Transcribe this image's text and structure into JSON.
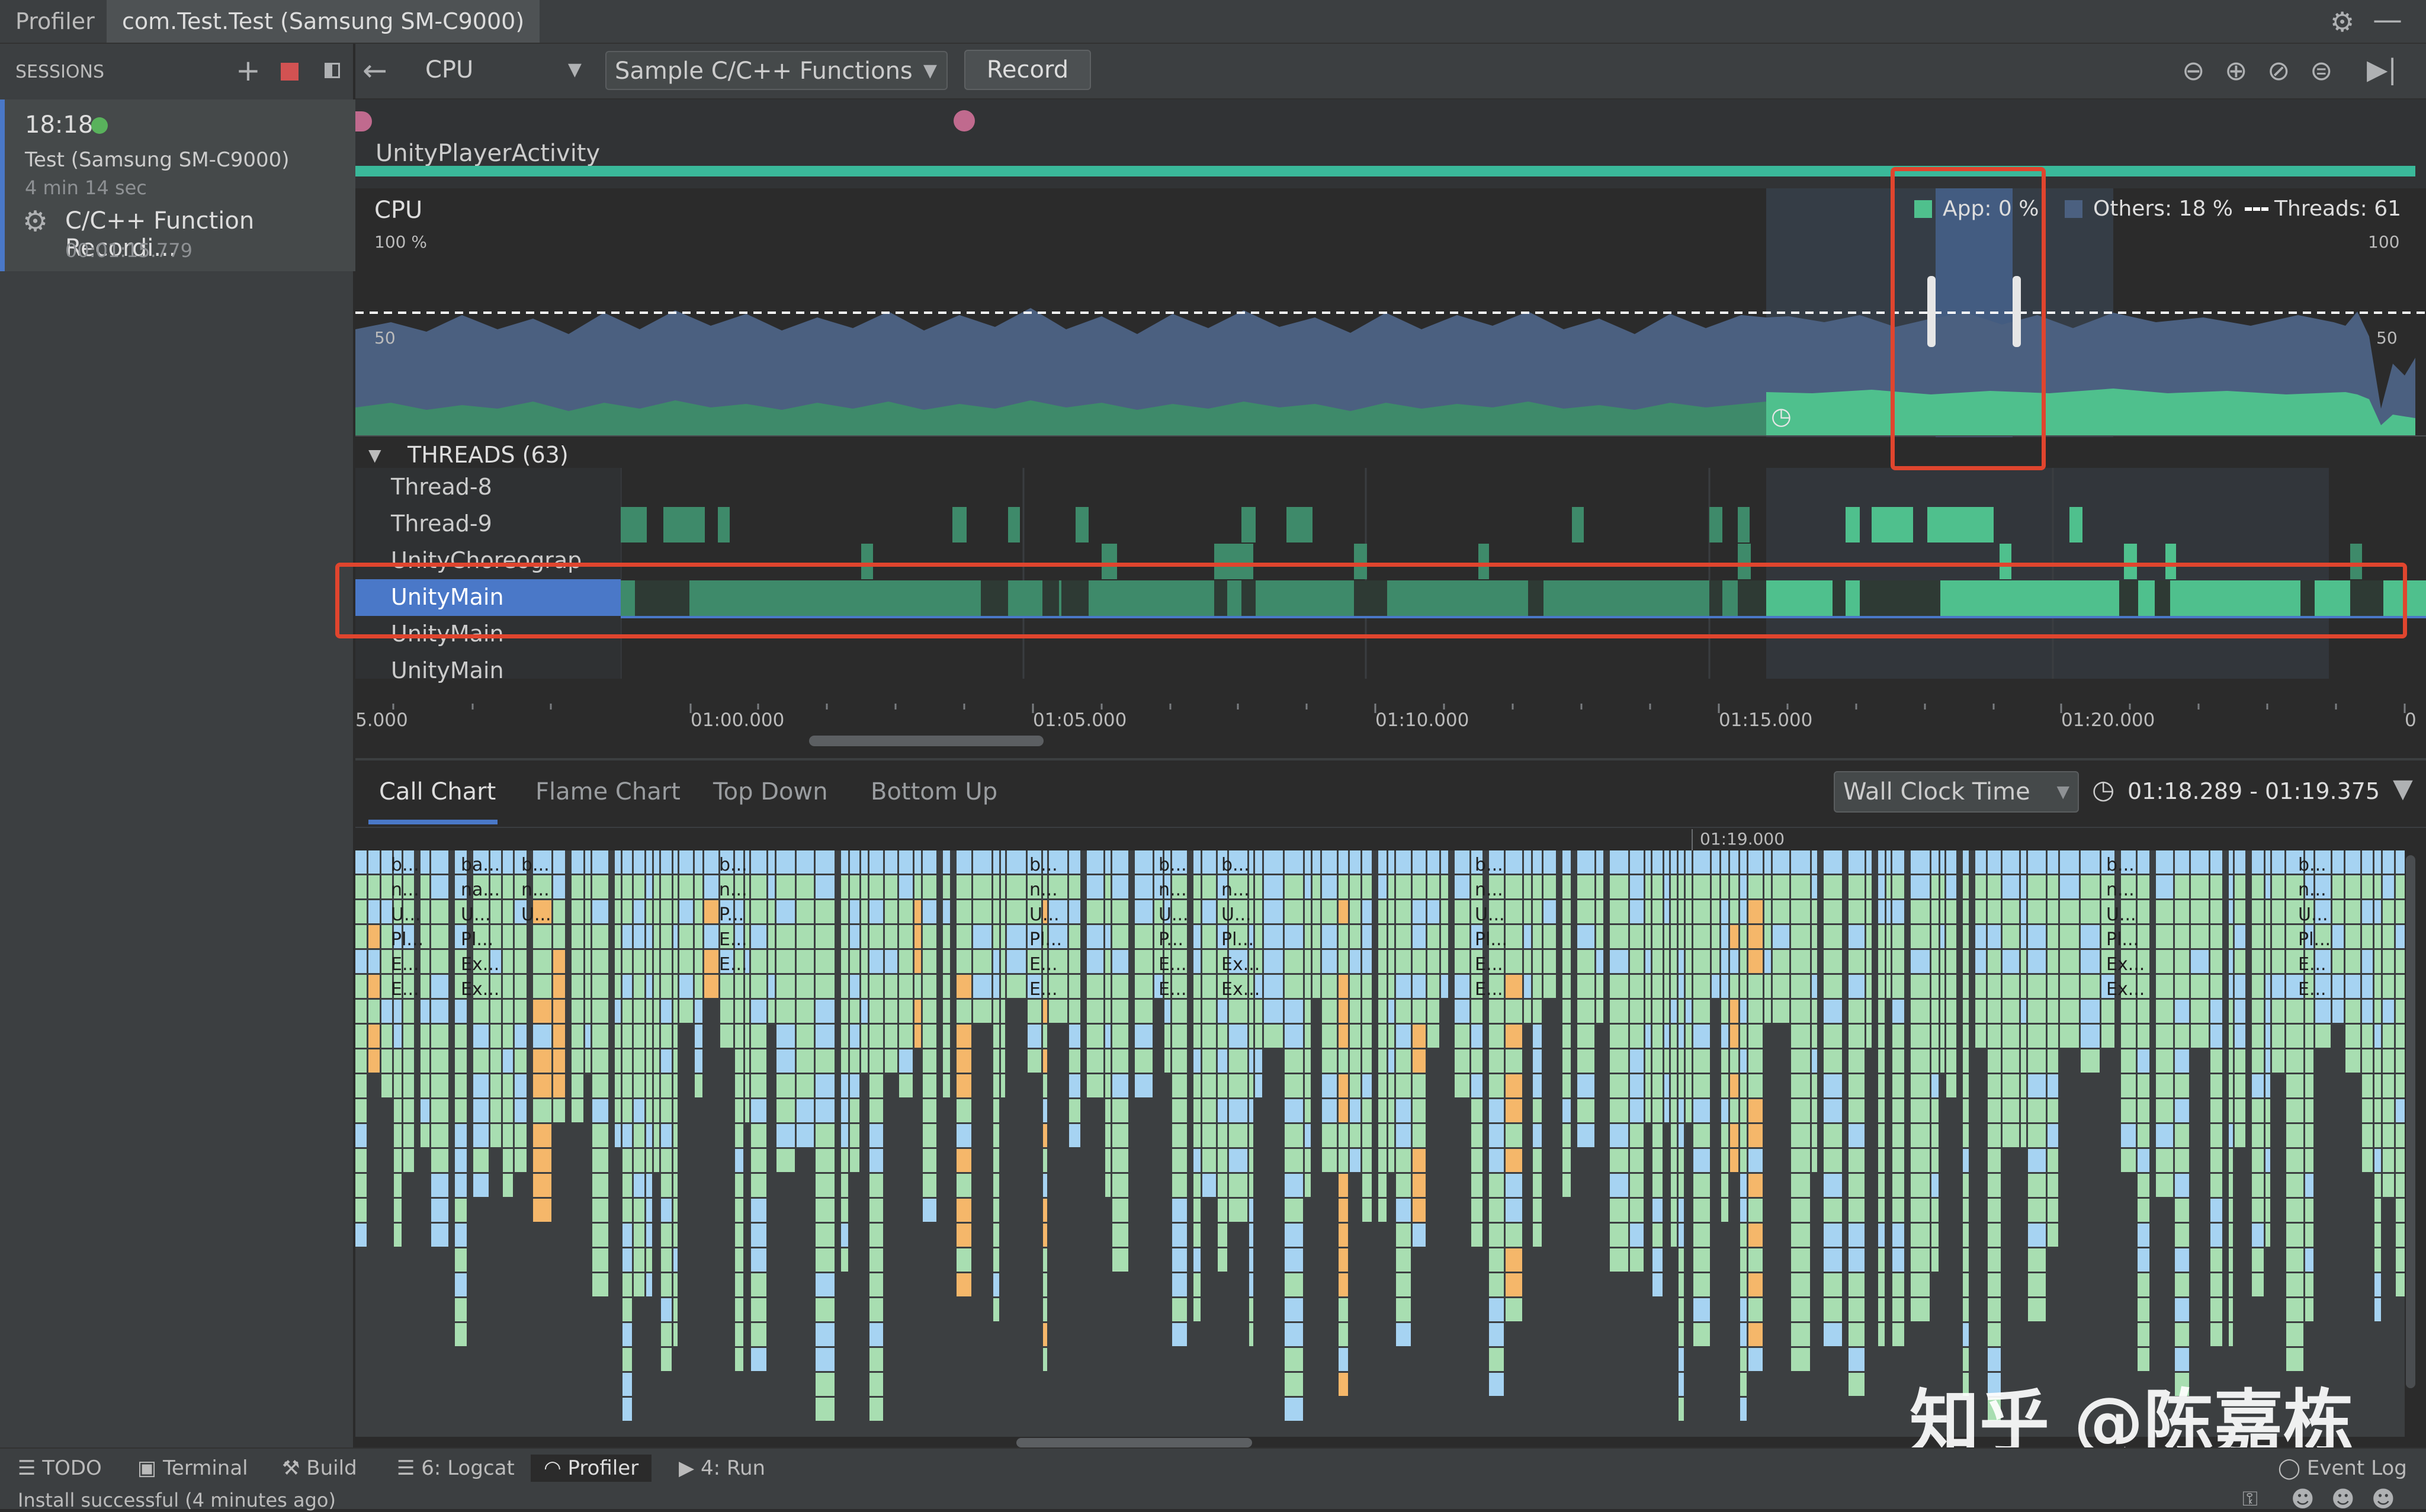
{
  "tabs": {
    "profiler": "Profiler",
    "device_tab": "com.Test.Test (Samsung SM-C9000)"
  },
  "sessions": {
    "header": "SESSIONS",
    "time": "18:18",
    "device": "Test (Samsung SM-C9000)",
    "duration": "4 min 14 sec",
    "recording_label": "C/C++ Function Recordi...",
    "recording_time": "00:01:15.779"
  },
  "toolbar": {
    "monitor_value": "CPU",
    "config_value": "Sample C/C++ Functions",
    "record_label": "Record"
  },
  "activity": {
    "name": "UnityPlayerActivity"
  },
  "cpu": {
    "title": "CPU",
    "y_top_left": "100 %",
    "y_mid_left": "50",
    "y_top_right": "100",
    "y_mid_right": "50",
    "legend_app": "App: 0 %",
    "legend_others": "Others: 18 %",
    "legend_threads": "Threads: 61",
    "color_app": "#4fc08d",
    "color_others": "#4b6080"
  },
  "threads": {
    "header": "THREADS (63)",
    "rows": [
      "Thread-8",
      "Thread-9",
      "UnityChoreograp",
      "UnityMain",
      "UnityMain",
      "UnityMain"
    ],
    "selected_color": "#4a78c8"
  },
  "axis": {
    "ticks": [
      "5.000",
      "01:00.000",
      "01:05.000",
      "01:10.000",
      "01:15.000",
      "01:20.000",
      "0"
    ]
  },
  "analysis": {
    "tabs": [
      "Call Chart",
      "Flame Chart",
      "Top Down",
      "Bottom Up"
    ],
    "clock_mode": "Wall Clock Time",
    "range": "01:18.289 - 01:19.375",
    "time_marker": "01:19.000",
    "col_labels": [
      [
        "b...",
        "n...",
        "U...",
        "Pl...",
        "E...",
        "E..."
      ],
      [
        "ba...",
        "na...",
        "U...",
        "Pl...",
        "Ex...",
        "Ex..."
      ],
      [
        "b...",
        "n...",
        "U..."
      ],
      [
        "b...",
        "n...",
        "",
        "P...",
        "E...",
        "E..."
      ],
      [
        "b...",
        "n...",
        "U...",
        "Pl...",
        "E...",
        "E..."
      ],
      [
        "b...",
        "n...",
        "U...",
        "P...",
        "E...",
        "E..."
      ],
      [
        "b...",
        "n...",
        "U...",
        "Pl...",
        "Ex...",
        "Ex..."
      ],
      [
        "b...",
        "n...",
        "U...",
        "Pl...",
        "E...",
        "E..."
      ],
      [
        "b...",
        "n...",
        "U...",
        "Pl...",
        "Ex...",
        "Ex..."
      ],
      [
        "b...",
        "n...",
        "U...",
        "Pl...",
        "E...",
        "E..."
      ]
    ],
    "color_green": "#a8deb1",
    "color_blue": "#a6d3f2",
    "color_orange": "#f5b76a"
  },
  "status": {
    "tools": [
      "TODO",
      "Terminal",
      "Build",
      "6: Logcat",
      "Profiler",
      "4: Run"
    ],
    "event_log": "Event Log",
    "message": "Install successful (4 minutes ago)"
  },
  "watermark": "知乎 @陈嘉栋"
}
